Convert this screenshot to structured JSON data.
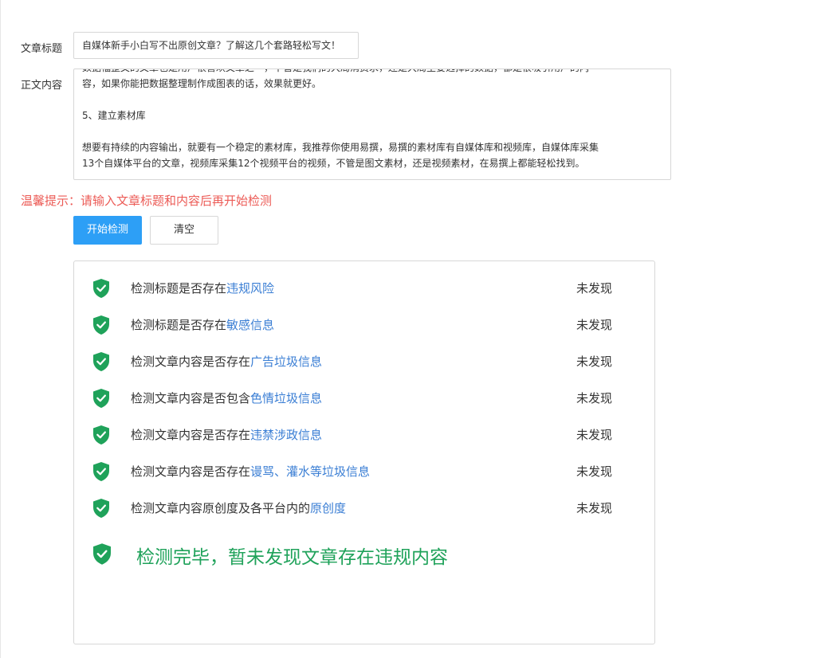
{
  "form": {
    "title_label": "文章标题",
    "title_value": "自媒体新手小白写不出原创文章？了解这几个套路轻松写文！",
    "content_label": "正文内容",
    "content_lines": [
      "数据福整文的文章也是用户很喜欢文章之一，不管是我们的大局消费求，还是大局主要选择的数据，都是很吸引用户的内",
      "容，如果你能把数据整理制作成图表的话，效果就更好。",
      "",
      "5、建立素材库",
      "",
      "想要有持续的内容输出，就要有一个稳定的素材库，我推荐你使用易撰，易撰的素材库有自媒体库和视频库，自媒体库采集",
      "13个自媒体平台的文章，视频库采集12个视频平台的视频，不管是图文素材，还是视频素材，在易撰上都能轻松找到。"
    ]
  },
  "tip": "温馨提示：请输入文章标题和内容后再开始检测",
  "buttons": {
    "start": "开始检测",
    "clear": "清空"
  },
  "results": {
    "items": [
      {
        "prefix": "检测标题是否存在",
        "highlight": "违规风险",
        "status": "未发现"
      },
      {
        "prefix": "检测标题是否存在",
        "highlight": "敏感信息",
        "status": "未发现"
      },
      {
        "prefix": "检测文章内容是否存在",
        "highlight": "广告垃圾信息",
        "status": "未发现"
      },
      {
        "prefix": "检测文章内容是否包含",
        "highlight": "色情垃圾信息",
        "status": "未发现"
      },
      {
        "prefix": "检测文章内容是否存在",
        "highlight": "违禁涉政信息",
        "status": "未发现"
      },
      {
        "prefix": "检测文章内容是否存在",
        "highlight": "谩骂、灌水等垃圾信息",
        "status": "未发现"
      },
      {
        "prefix": "检测文章内容原创度及各平台内的",
        "highlight": "原创度",
        "status": "未发现"
      }
    ],
    "summary": "检测完毕，暂未发现文章存在违规内容",
    "icon": "shield-check-icon"
  },
  "colors": {
    "accent_blue": "#2d9ff6",
    "link_blue": "#3a7ed4",
    "tip_red": "#ec5b56",
    "success_green": "#1fa25a",
    "shield_green": "#1fa25a"
  }
}
